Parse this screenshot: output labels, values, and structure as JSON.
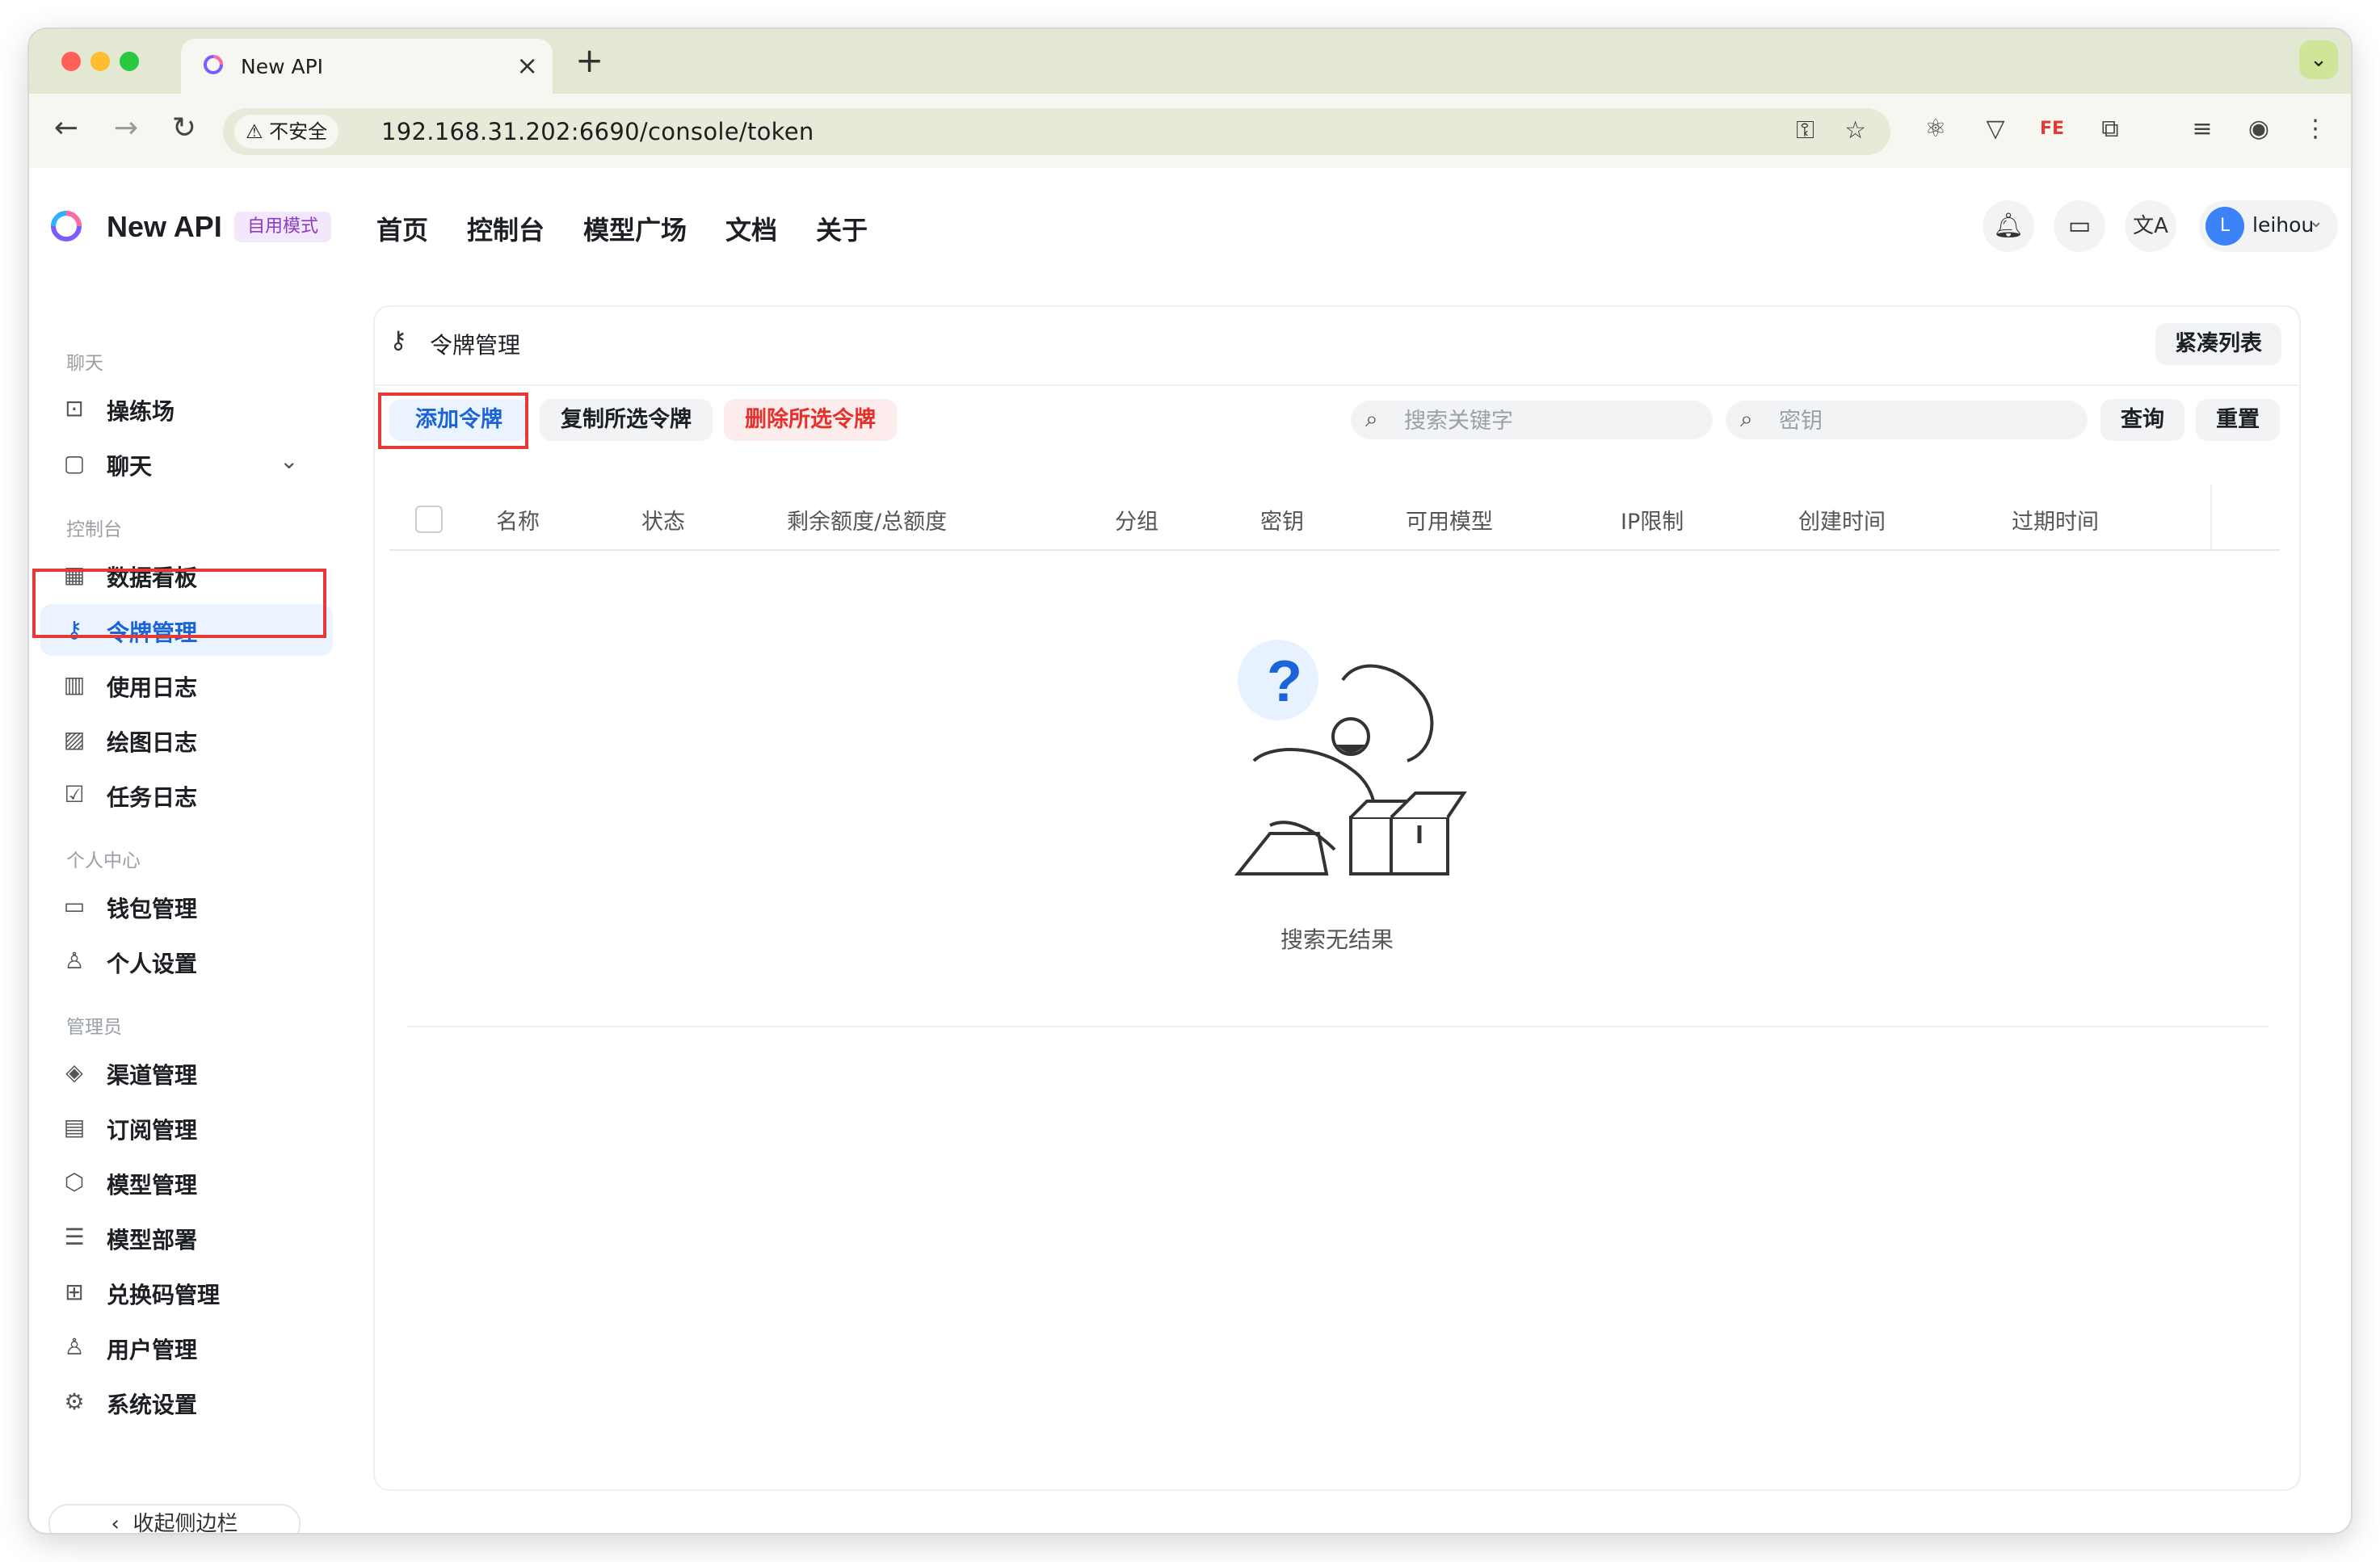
{
  "browser": {
    "tab_title": "New API",
    "insecure_label": "不安全",
    "url": "192.168.31.202:6690/console/token"
  },
  "header": {
    "brand": "New API",
    "mode_badge": "自用模式",
    "nav": [
      "首页",
      "控制台",
      "模型广场",
      "文档",
      "关于"
    ],
    "avatar_letter": "L",
    "username": "leihou"
  },
  "sidebar": {
    "sections": {
      "chat": "聊天",
      "console": "控制台",
      "personal": "个人中心",
      "admin": "管理员"
    },
    "items": {
      "playground": "操练场",
      "chat": "聊天",
      "dashboard": "数据看板",
      "token": "令牌管理",
      "usage_log": "使用日志",
      "draw_log": "绘图日志",
      "task_log": "任务日志",
      "wallet": "钱包管理",
      "personal_settings": "个人设置",
      "channel": "渠道管理",
      "subscription": "订阅管理",
      "model": "模型管理",
      "deploy": "模型部署",
      "redeem": "兑换码管理",
      "user": "用户管理",
      "system": "系统设置"
    },
    "active_item": "令牌管理",
    "collapse_label": "收起侧边栏"
  },
  "main": {
    "title": "令牌管理",
    "compact_label": "紧凑列表",
    "actions": {
      "add": "添加令牌",
      "copy_selected": "复制所选令牌",
      "delete_selected": "删除所选令牌"
    },
    "search_keyword": {
      "placeholder": "搜索关键字",
      "value": ""
    },
    "search_key": {
      "placeholder": "密钥",
      "value": ""
    },
    "query_label": "查询",
    "reset_label": "重置",
    "columns": [
      "名称",
      "状态",
      "剩余额度/总额度",
      "分组",
      "密钥",
      "可用模型",
      "IP限制",
      "创建时间",
      "过期时间"
    ],
    "rows": [],
    "empty_text": "搜索无结果"
  },
  "colors": {
    "accent": "#1a64d8",
    "danger": "#e5302b",
    "badge_bg": "#f3e8fb",
    "badge_text": "#8d3bbf",
    "annotation": "#e53935"
  }
}
